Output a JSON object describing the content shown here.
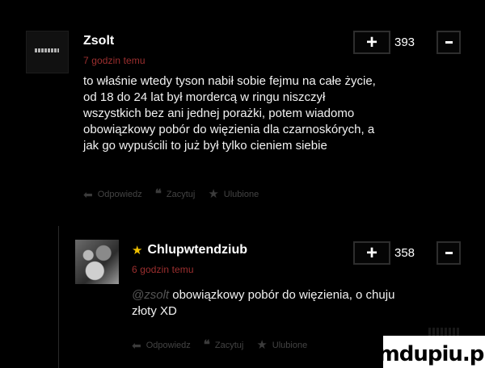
{
  "comments": [
    {
      "username": "Zsolt",
      "time": "7 godzin temu",
      "score": "393",
      "plus": "+",
      "text_lines": [
        "to właśnie wtedy tyson nabił sobie fejmu na całe życie,",
        "od 18 do 24 lat był mordercą w ringu niszczył",
        "wszystkich bez ani jednej porażki, potem wiadomo",
        "obowiązkowy pobór do więzienia dla czarnoskórych, a",
        "jak go wypuścili to już był tylko cieniem siebie"
      ],
      "actions": {
        "reply": "Odpowiedz",
        "quote": "Zacytuj",
        "favorite": "Ulubione"
      }
    },
    {
      "username": "Chlupwtendziub",
      "time": "6 godzin temu",
      "score": "358",
      "plus": "+",
      "mention": "@zsolt",
      "text_line1": "obowiązkowy pobór do więzienia, o chuju",
      "text_line2": "złoty XD",
      "actions": {
        "reply": "Odpowiedz",
        "quote": "Zacytuj",
        "favorite": "Ulubione"
      }
    }
  ],
  "watermark": "mdupiu.pl",
  "colors": {
    "time": "#9c2f2f",
    "star": "#f0c000",
    "muted": "#444444"
  },
  "icons": {
    "reply": "reply-arrow-icon",
    "quote": "quote-icon",
    "favorite": "star-icon",
    "badge": "star-badge-icon"
  }
}
